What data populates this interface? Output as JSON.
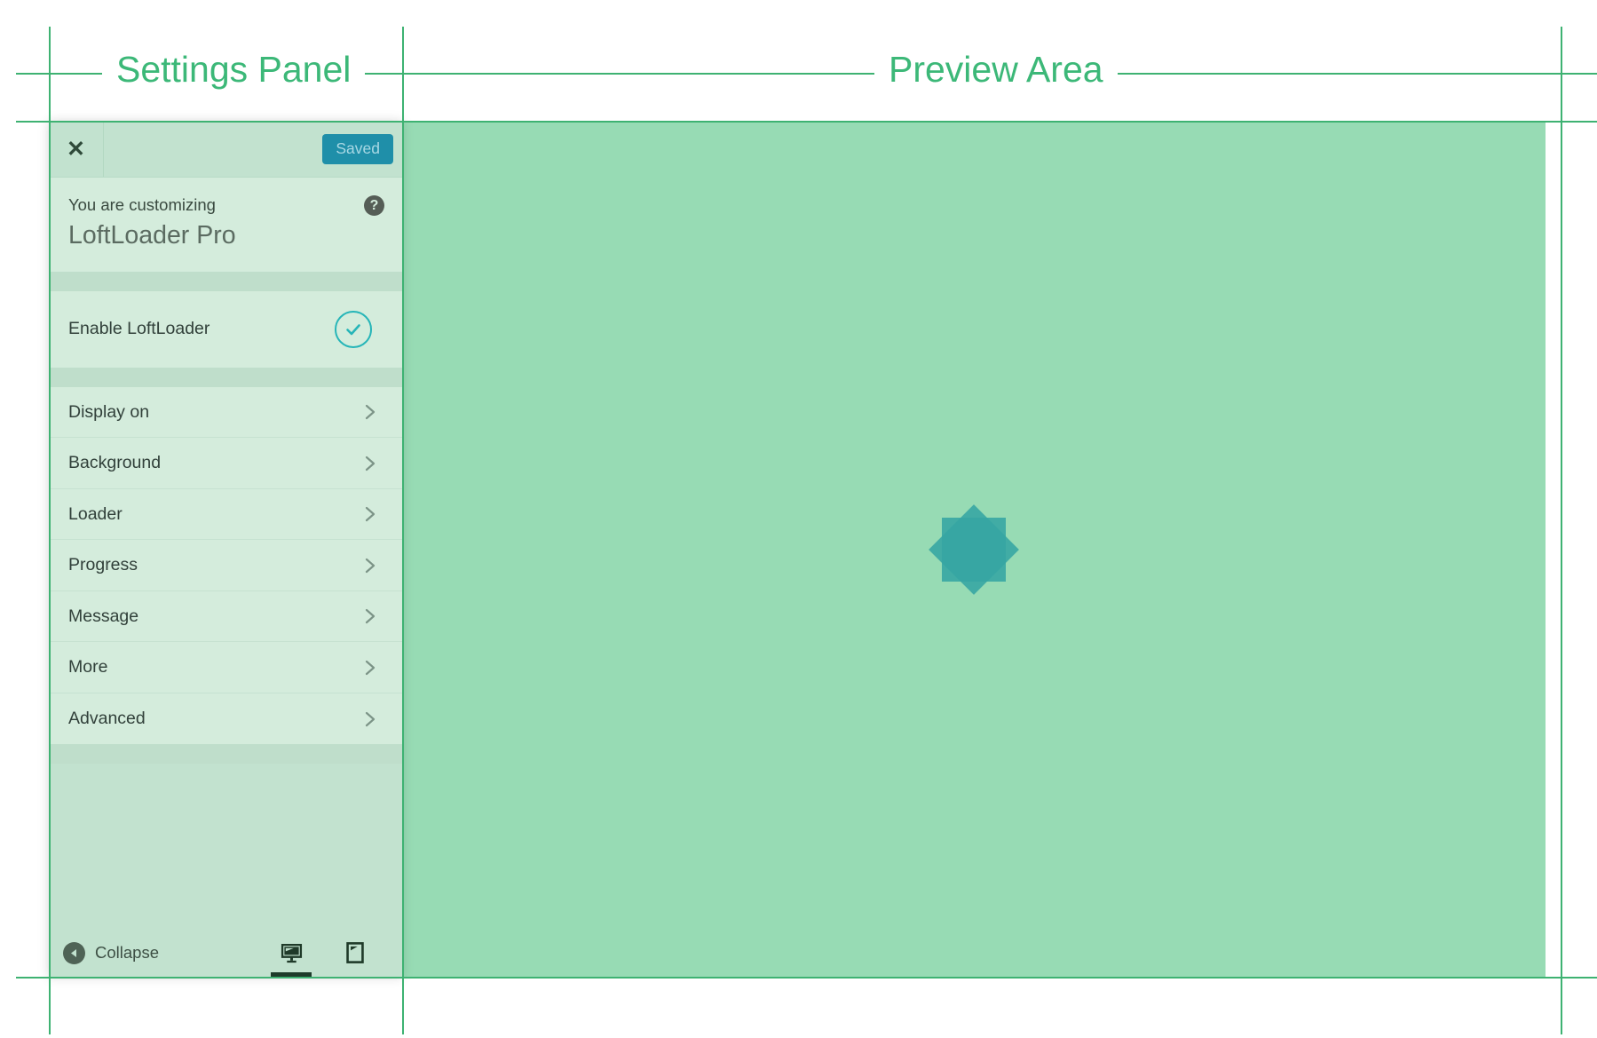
{
  "annotations": {
    "settings_panel_label": "Settings Panel",
    "preview_area_label": "Preview Area",
    "guide_color": "#3eb272",
    "label_color": "#3cb878"
  },
  "customizer": {
    "topbar": {
      "close_label": "✕",
      "save_button_label": "Saved",
      "save_button_color": "#1f8fa9"
    },
    "header": {
      "subtitle": "You are customizing",
      "title": "LoftLoader Pro",
      "help_label": "?"
    },
    "enable": {
      "label": "Enable LoftLoader",
      "checked": true,
      "accent_color": "#26b5b8"
    },
    "sections": [
      {
        "label": "Display on"
      },
      {
        "label": "Background"
      },
      {
        "label": "Loader"
      },
      {
        "label": "Progress"
      },
      {
        "label": "Message"
      },
      {
        "label": "More"
      },
      {
        "label": "Advanced"
      }
    ],
    "footer": {
      "collapse_label": "Collapse",
      "devices": [
        {
          "name": "desktop",
          "active": true
        },
        {
          "name": "tablet",
          "active": false
        },
        {
          "name": "mobile",
          "active": false
        }
      ]
    },
    "panel_bg": "#c2e2cf",
    "row_bg": "#d4ecdc"
  },
  "preview": {
    "background_color": "#97dbb4",
    "loader": {
      "shape": "eight-point-star",
      "color": "#35a5a3"
    }
  }
}
